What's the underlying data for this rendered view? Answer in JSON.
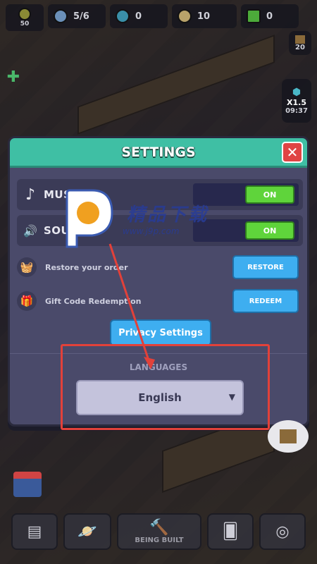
{
  "hud": {
    "level": "50",
    "workers": "5/6",
    "gems": "0",
    "food": "10",
    "blocks": "0"
  },
  "side": {
    "crate_count": "20",
    "speed": "X1.5",
    "timer": "09:37"
  },
  "settings": {
    "title": "SETTINGS",
    "close_icon": "close-icon",
    "music": {
      "label": "MUSIC",
      "state": "ON"
    },
    "sound": {
      "label": "SOUND",
      "state": "ON"
    },
    "restore": {
      "label": "Restore your order",
      "button": "RESTORE"
    },
    "gift": {
      "label": "Gift Code Redemption",
      "button": "REDEEM"
    },
    "privacy_button": "Privacy Settings",
    "languages_heading": "LANGUAGES",
    "language_selected": "English"
  },
  "watermark": {
    "brand": "精品下载",
    "url": "www.j9p.com"
  },
  "toolbar": {
    "being_built": "BEING BUILT"
  },
  "colors": {
    "header": "#3fbfa4",
    "toggle_on": "#5fd43b",
    "action_button": "#3eaef0",
    "close_button": "#e04444",
    "annotation": "#e2413a"
  }
}
